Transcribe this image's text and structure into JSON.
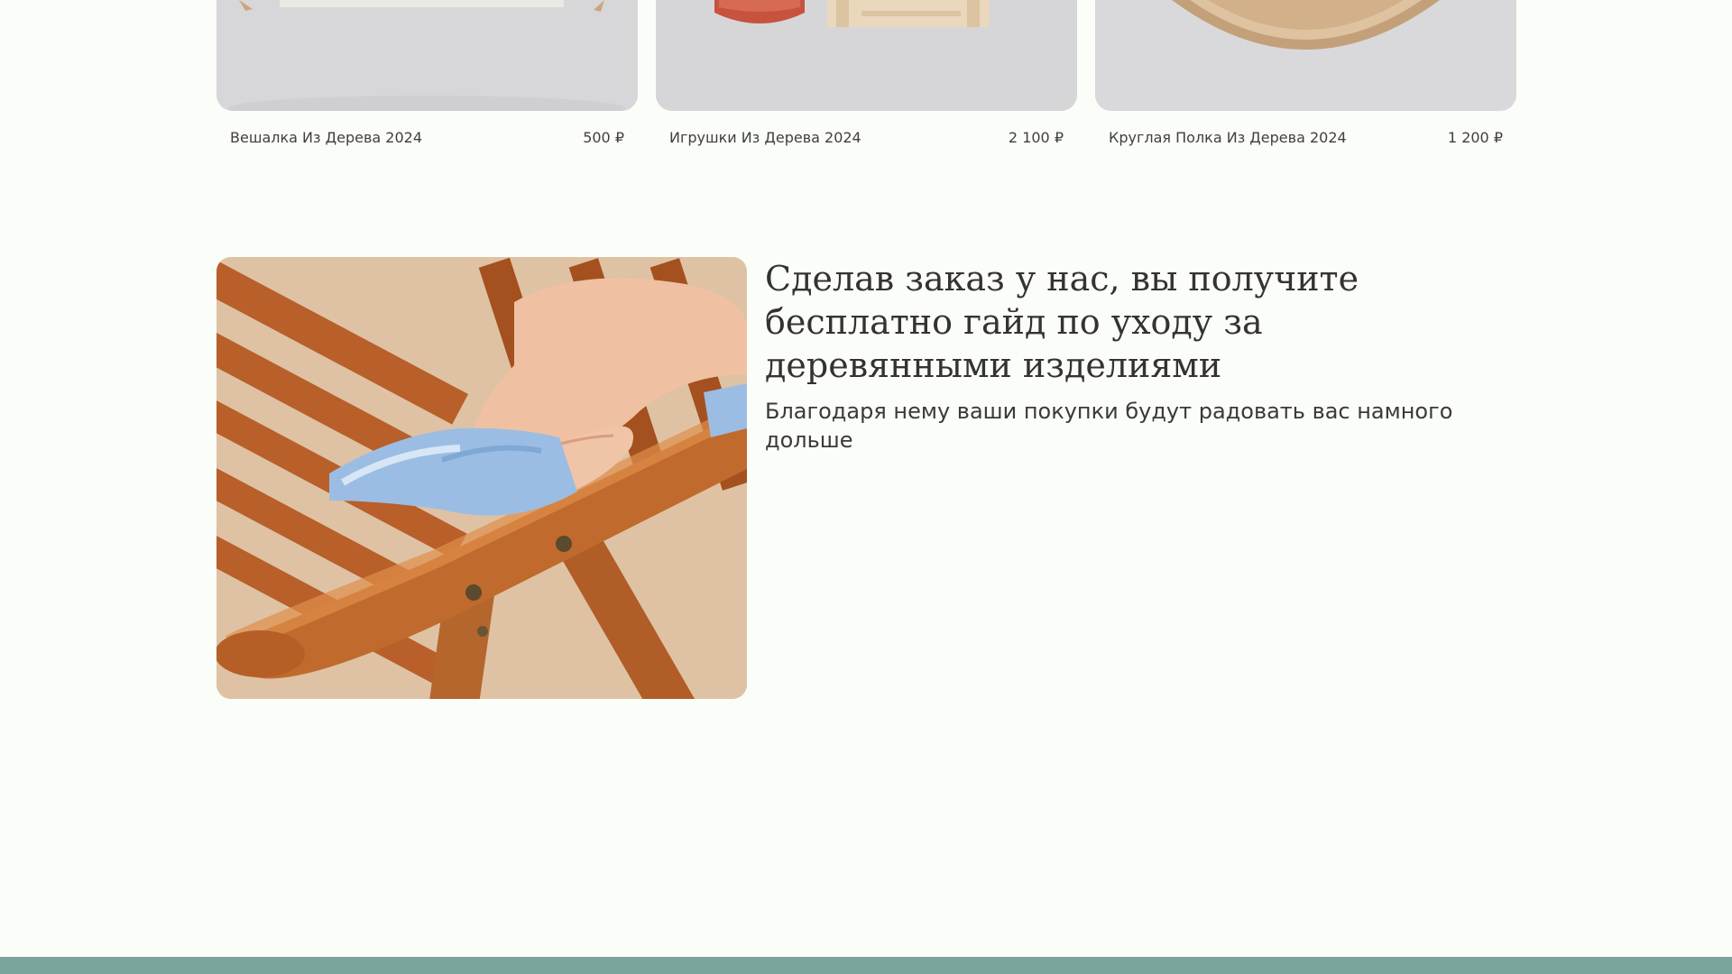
{
  "products": [
    {
      "name": "Вешалка Из Дерева 2024",
      "price": "500 ₽",
      "image": "wooden-hanger-photo"
    },
    {
      "name": "Игрушки Из Дерева 2024",
      "price": "2 100 ₽",
      "image": "wooden-toys-photo"
    },
    {
      "name": "Круглая Полка Из Дерева 2024",
      "price": "1 200 ₽",
      "image": "round-wooden-shelf-photo"
    }
  ],
  "care_section": {
    "title": "Сделав заказ у нас, вы получите бесплатно гайд по уходу за деревянными изделиями",
    "text": "Благодаря нему ваши покупки будут радовать вас намного дольше",
    "image": "hand-wiping-wooden-chair-photo"
  },
  "colors": {
    "background": "#fbfdf8",
    "footer_band": "#7aa49c",
    "text": "#3a3a3a"
  }
}
